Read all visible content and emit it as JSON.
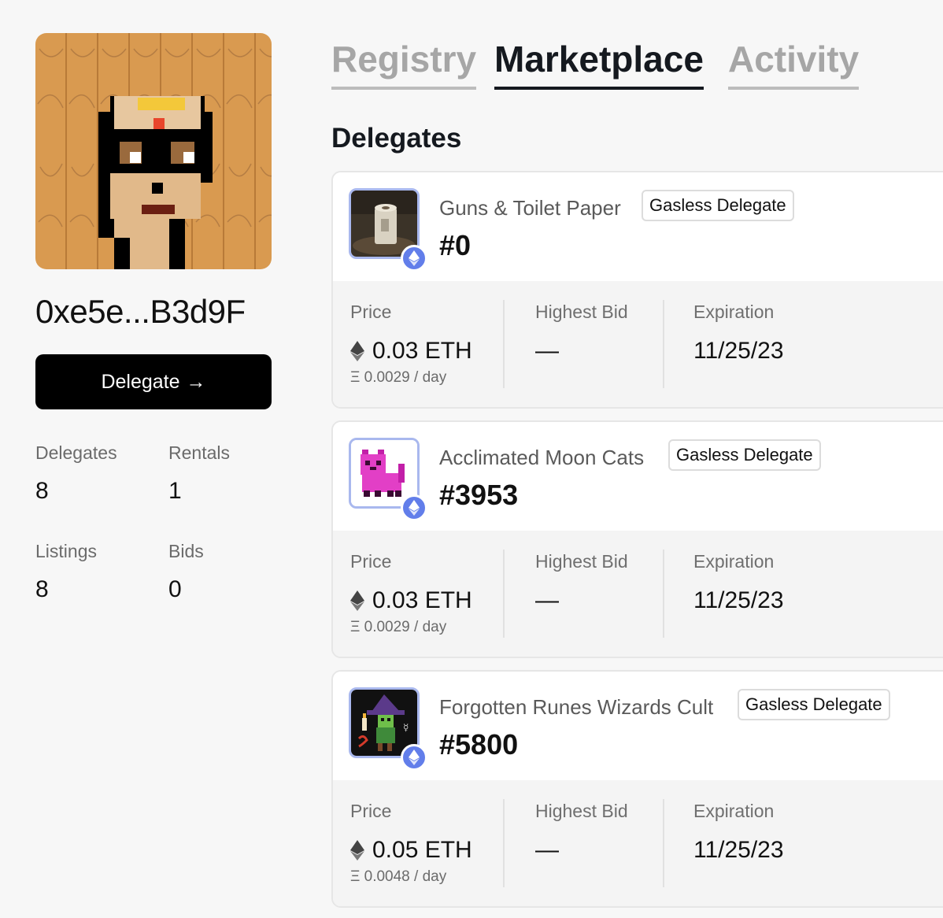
{
  "profile": {
    "address": "0xe5e...B3d9F",
    "delegate_button": "Delegate",
    "arrow": "→",
    "stats": [
      {
        "label": "Delegates",
        "value": "8"
      },
      {
        "label": "Rentals",
        "value": "1"
      },
      {
        "label": "Listings",
        "value": "8"
      },
      {
        "label": "Bids",
        "value": "0"
      }
    ]
  },
  "tabs": [
    {
      "label": "Registry",
      "active": false
    },
    {
      "label": "Marketplace",
      "active": true
    },
    {
      "label": "Activity",
      "active": false
    }
  ],
  "section_title": "Delegates",
  "labels": {
    "price": "Price",
    "highest_bid": "Highest Bid",
    "expiration": "Expiration"
  },
  "cards": [
    {
      "collection": "Guns & Toilet Paper",
      "badge": "Gasless Delegate",
      "token_id": "#0",
      "price": "0.03 ETH",
      "per_day": "Ξ 0.0029 / day",
      "highest_bid": "—",
      "expiration": "11/25/23",
      "thumb_icon": "toilet-paper-thumbnail"
    },
    {
      "collection": "Acclimated Moon Cats",
      "badge": "Gasless Delegate",
      "token_id": "#3953",
      "price": "0.03 ETH",
      "per_day": "Ξ 0.0029 / day",
      "highest_bid": "—",
      "expiration": "11/25/23",
      "thumb_icon": "moon-cat-thumbnail"
    },
    {
      "collection": "Forgotten Runes Wizards Cult",
      "badge": "Gasless Delegate",
      "token_id": "#5800",
      "price": "0.05 ETH",
      "per_day": "Ξ 0.0048 / day",
      "highest_bid": "—",
      "expiration": "11/25/23",
      "thumb_icon": "wizard-thumbnail"
    }
  ],
  "colors": {
    "accent": "#627eea",
    "text": "#15191f",
    "muted": "#6b6b6b",
    "button": "#000000"
  }
}
